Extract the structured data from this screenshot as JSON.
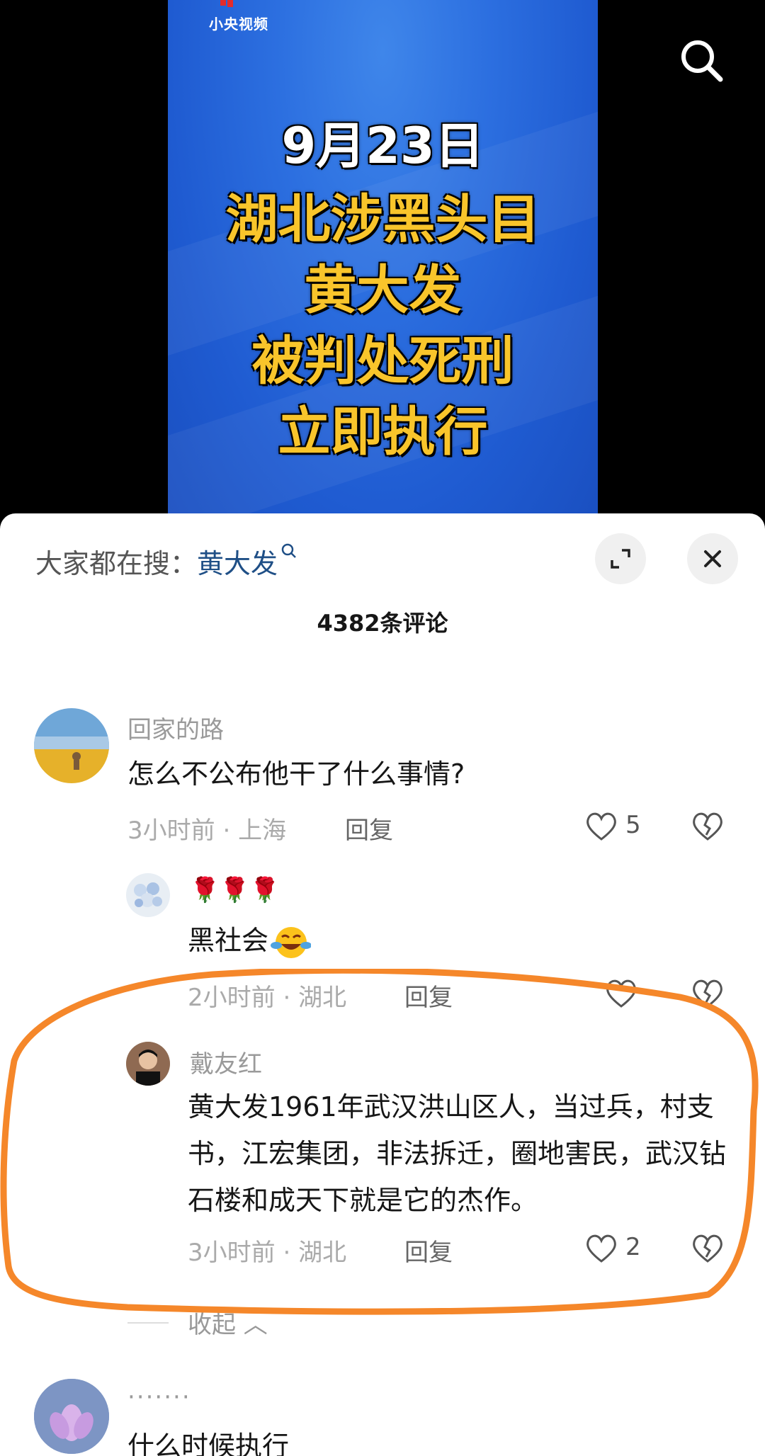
{
  "video": {
    "brand": "小央视频",
    "headline": [
      "9月23日",
      "湖北涉黑头目",
      "黄大发",
      "被判处死刑",
      "立即执行"
    ],
    "search_icon": "search-icon"
  },
  "comments_sheet": {
    "hot_search_label": "大家都在搜：",
    "hot_search_keyword": "黄大发",
    "comment_count": "4382条评论",
    "comments": [
      {
        "user": "回家的路",
        "text": "怎么不公布他干了什么事情?",
        "time": "3小时前",
        "location": "上海",
        "reply": "回复",
        "likes": "5"
      },
      {
        "user": "🌹🌹🌹",
        "text": "黑社会",
        "time": "2小时前",
        "location": "湖北",
        "reply": "回复",
        "likes": ""
      },
      {
        "user": "戴友红",
        "text": "黄大发1961年武汉洪山区人，当过兵，村支书，江宏集团，非法拆迁，圈地害民，武汉钻石楼和成天下就是它的杰作。",
        "time": "3小时前",
        "location": "湖北",
        "reply": "回复",
        "likes": "2"
      },
      {
        "user": "·······",
        "text": "什么时候执行"
      }
    ],
    "collapse_label": "收起",
    "annotation_color": "#f5872a"
  }
}
